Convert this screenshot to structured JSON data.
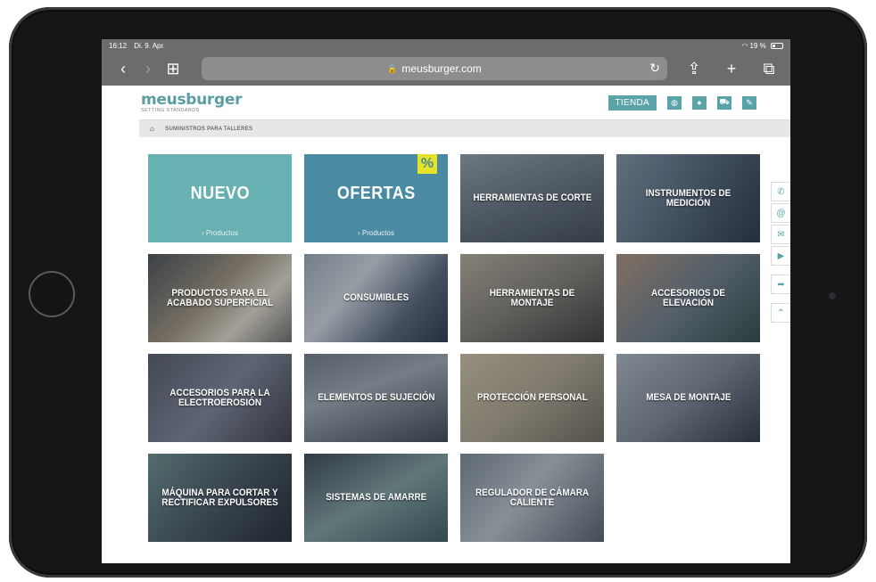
{
  "statusbar": {
    "time": "16:12",
    "date": "Di. 9. Apr.",
    "battery": "19 %"
  },
  "browser": {
    "url": "meusburger.com"
  },
  "site": {
    "logo": "meusburger",
    "tagline": "SETTING STANDARDS",
    "shop_label": "TIENDA"
  },
  "breadcrumb": {
    "current": "SUMINISTROS PARA TALLERES"
  },
  "tiles": [
    {
      "label": "NUEVO",
      "sub": "› Productos"
    },
    {
      "label": "OFERTAS",
      "sub": "› Productos",
      "badge": "%"
    },
    {
      "label": "HERRAMIENTAS DE CORTE"
    },
    {
      "label": "INSTRUMENTOS DE MEDICIÓN"
    },
    {
      "label": "PRODUCTOS PARA EL ACABADO SUPERFICIAL"
    },
    {
      "label": "CONSUMIBLES"
    },
    {
      "label": "HERRAMIENTAS DE MONTAJE"
    },
    {
      "label": "ACCESORIOS DE ELEVACIÓN"
    },
    {
      "label": "ACCESORIOS PARA LA ELECTROEROSIÓN"
    },
    {
      "label": "ELEMENTOS DE SUJECIÓN"
    },
    {
      "label": "PROTECCIÓN PERSONAL"
    },
    {
      "label": "MESA DE MONTAJE"
    },
    {
      "label": "MÁQUINA PARA CORTAR Y RECTIFICAR EXPULSORES"
    },
    {
      "label": "SISTEMAS DE AMARRE"
    },
    {
      "label": "REGULADOR DE CÁMARA CALIENTE"
    }
  ],
  "colors": {
    "brand": "#5aa3a8",
    "nuevo": "#67b1b2",
    "ofertas": "#4a8aa3",
    "badge": "#e4e32a"
  }
}
